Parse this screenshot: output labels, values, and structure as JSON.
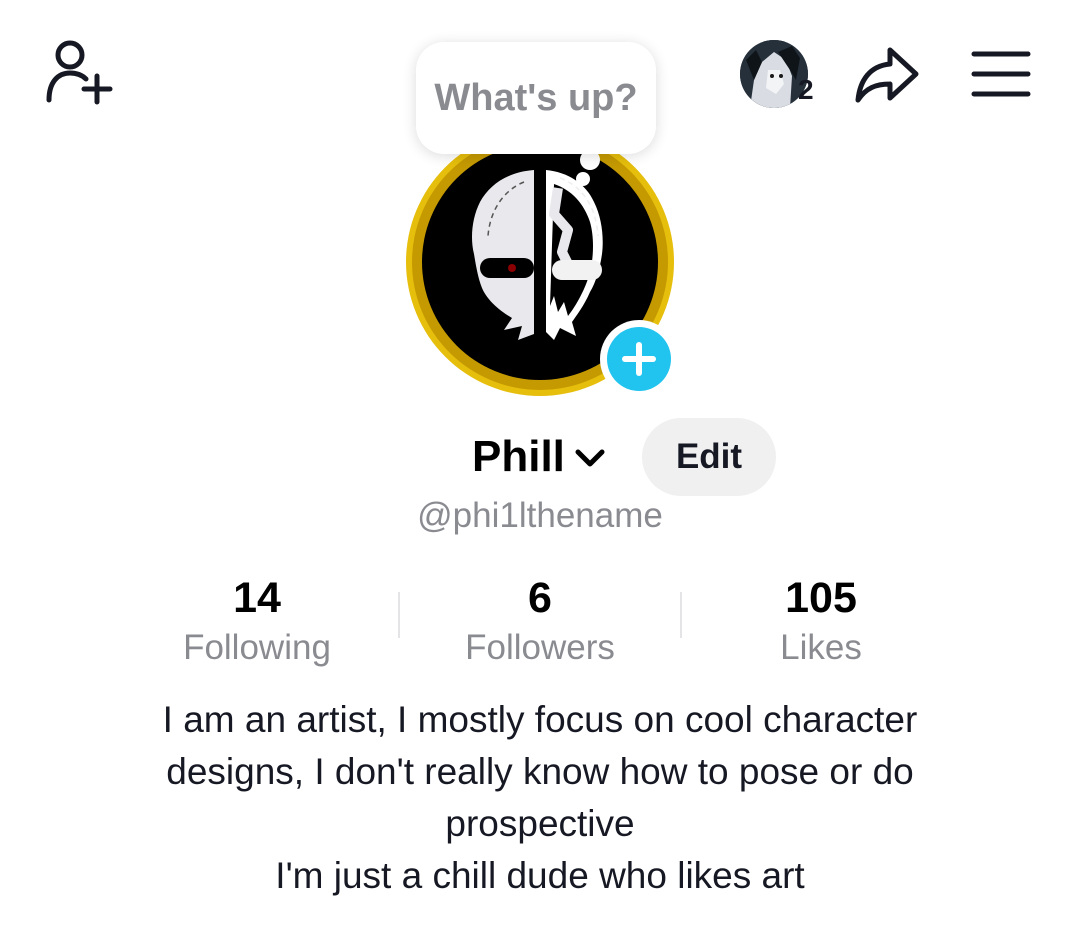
{
  "header": {
    "story_count": "2",
    "icons": {
      "add_friend": "person-add-icon",
      "share": "share-arrow-icon",
      "menu": "hamburger-menu-icon"
    }
  },
  "bubble": {
    "text": "What's up?"
  },
  "profile": {
    "name": "Phill",
    "edit_label": "Edit",
    "handle": "@phi1lthename",
    "avatar_ring_color": "#e6be0c",
    "add_story_color": "#20c4ef"
  },
  "stats": [
    {
      "value": "14",
      "label": "Following"
    },
    {
      "value": "6",
      "label": "Followers"
    },
    {
      "value": "105",
      "label": "Likes"
    }
  ],
  "bio": [
    "I am an artist, I mostly focus on cool character",
    "designs, I don't really know how to pose or do",
    "prospective",
    "I'm just a chill dude who likes art"
  ]
}
